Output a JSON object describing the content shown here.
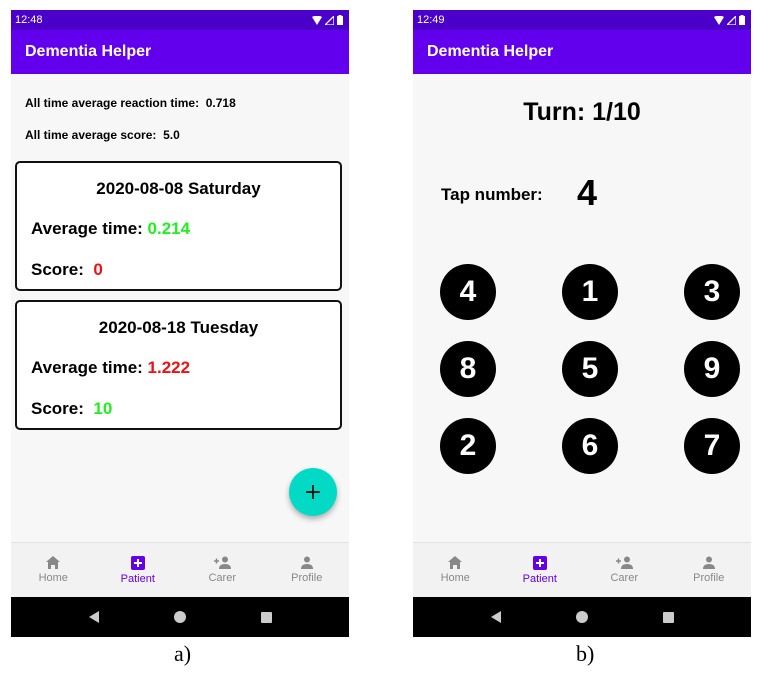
{
  "screens": {
    "a": {
      "status_time": "12:48",
      "app_title": "Dementia Helper",
      "summary": {
        "reaction_label": "All time average reaction time:",
        "reaction_value": "0.718",
        "score_label": "All time average score:",
        "score_value": "5.0"
      },
      "cards": [
        {
          "date": "2020-08-08 Saturday",
          "time_label": "Average time:",
          "time_value": "0.214",
          "score_label": "Score:",
          "score_value": "0"
        },
        {
          "date": "2020-08-18 Tuesday",
          "time_label": "Average time:",
          "time_value": "1.222",
          "score_label": "Score:",
          "score_value": "10"
        }
      ],
      "fab_label": "+"
    },
    "b": {
      "status_time": "12:49",
      "app_title": "Dementia Helper",
      "turn": "Turn: 1/10",
      "tap_label": "Tap number:",
      "tap_number": "4",
      "numbers": [
        "4",
        "1",
        "3",
        "8",
        "5",
        "9",
        "2",
        "6",
        "7"
      ]
    }
  },
  "bottom_nav": [
    {
      "label": "Home",
      "icon": "home-icon"
    },
    {
      "label": "Patient",
      "icon": "patient-add-icon"
    },
    {
      "label": "Carer",
      "icon": "person-add-icon"
    },
    {
      "label": "Profile",
      "icon": "person-icon"
    }
  ],
  "captions": {
    "a": "a)",
    "b": "b)"
  },
  "colors": {
    "status_bar": "#4a00c8",
    "app_bar": "#6200ee",
    "nav_active": "#6200ee",
    "good": "#22ee22",
    "bad": "#ee1111",
    "fab": "#03dac5"
  }
}
